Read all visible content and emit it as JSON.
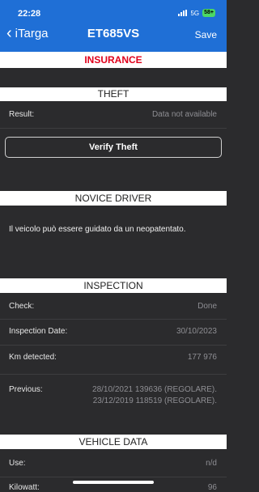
{
  "status_bar": {
    "time": "22:28",
    "network": "5G",
    "battery": "58+"
  },
  "nav": {
    "back_label": "iTarga",
    "back_icon": "‹",
    "title": "ET685VS",
    "save_label": "Save"
  },
  "banner": {
    "text": "INSURANCE"
  },
  "theft": {
    "header": "THEFT",
    "result_label": "Result:",
    "result_value": "Data not available",
    "verify_button": "Verify Theft"
  },
  "novice": {
    "header": "NOVICE DRIVER",
    "text": "Il veicolo può essere guidato da un neopatentato."
  },
  "inspection": {
    "header": "INSPECTION",
    "check_label": "Check:",
    "check_value": "Done",
    "date_label": "Inspection Date:",
    "date_value": "30/10/2023",
    "km_label": "Km detected:",
    "km_value": "177 976",
    "previous_label": "Previous:",
    "previous_values": [
      "28/10/2021 139636 (REGOLARE).",
      "23/12/2019 118519 (REGOLARE)."
    ]
  },
  "vehicle": {
    "header": "VEHICLE DATA",
    "use_label": "Use:",
    "use_value": "n/d",
    "kw_label": "Kilowatt:",
    "kw_value": "96"
  },
  "colors": {
    "nav_blue": "#1f6fd6",
    "insurance_red": "#e0001b",
    "background": "#2b2b2d"
  }
}
